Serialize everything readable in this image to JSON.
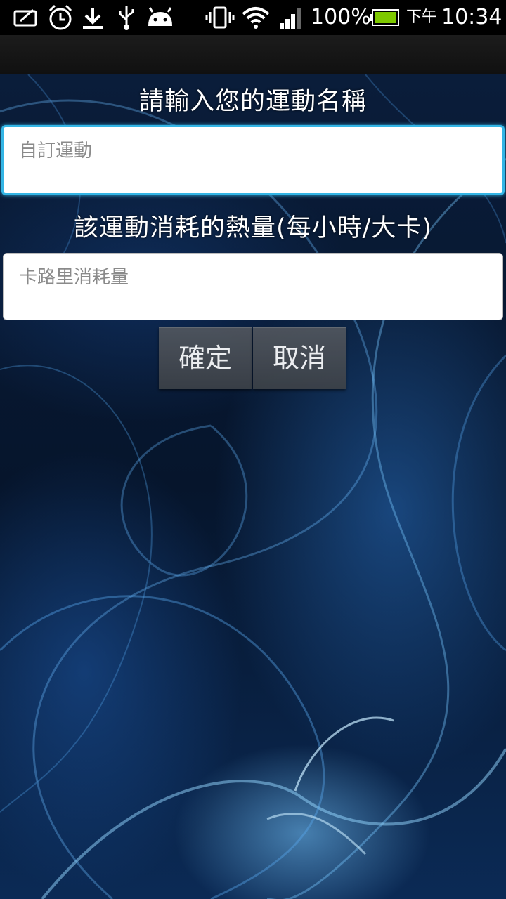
{
  "status_bar": {
    "battery_percent": "100%",
    "time_period": "下午",
    "time": "10:34",
    "icons": [
      "notification-icon",
      "alarm-icon",
      "download-icon",
      "usb-icon",
      "android-icon",
      "vibrate-icon",
      "wifi-icon",
      "signal-icon",
      "battery-icon"
    ]
  },
  "form": {
    "name_label": "請輸入您的運動名稱",
    "name_placeholder": "自訂運動",
    "calorie_label": "該運動消耗的熱量(每小時/大卡)",
    "calorie_placeholder": "卡路里消耗量"
  },
  "buttons": {
    "confirm": "確定",
    "cancel": "取消"
  },
  "colors": {
    "focus_accent": "#33b5e5",
    "battery_green": "#7ec800"
  }
}
